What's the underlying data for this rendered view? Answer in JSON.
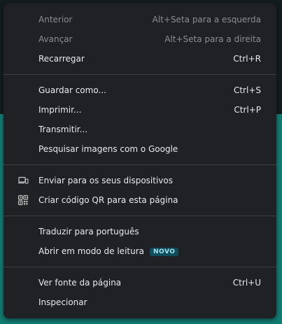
{
  "menu": {
    "groups": [
      {
        "items": [
          {
            "label": "Anterior",
            "shortcut": "Alt+Seta para a esquerda",
            "disabled": true
          },
          {
            "label": "Avançar",
            "shortcut": "Alt+Seta para a direita",
            "disabled": true
          },
          {
            "label": "Recarregar",
            "shortcut": "Ctrl+R",
            "disabled": false
          }
        ]
      },
      {
        "items": [
          {
            "label": "Guardar como...",
            "shortcut": "Ctrl+S"
          },
          {
            "label": "Imprimir...",
            "shortcut": "Ctrl+P"
          },
          {
            "label": "Transmitir..."
          },
          {
            "label": "Pesquisar imagens com o Google"
          }
        ]
      },
      {
        "items": [
          {
            "label": "Enviar para os seus dispositivos",
            "icon": "devices-icon"
          },
          {
            "label": "Criar código QR para esta página",
            "icon": "qr-code-icon"
          }
        ]
      },
      {
        "items": [
          {
            "label": "Traduzir para português"
          },
          {
            "label": "Abrir em modo de leitura",
            "badge": "NOVO"
          }
        ]
      },
      {
        "items": [
          {
            "label": "Ver fonte da página",
            "shortcut": "Ctrl+U"
          },
          {
            "label": "Inspecionar"
          }
        ]
      }
    ]
  },
  "colors": {
    "menu_bg": "#202124",
    "text": "#e8eaed",
    "disabled_text": "#8a8d91",
    "separator": "#3c4043",
    "background_teal": "#127a70",
    "badge_bg": "#0f4d5c",
    "badge_text": "#a8e4f0"
  }
}
